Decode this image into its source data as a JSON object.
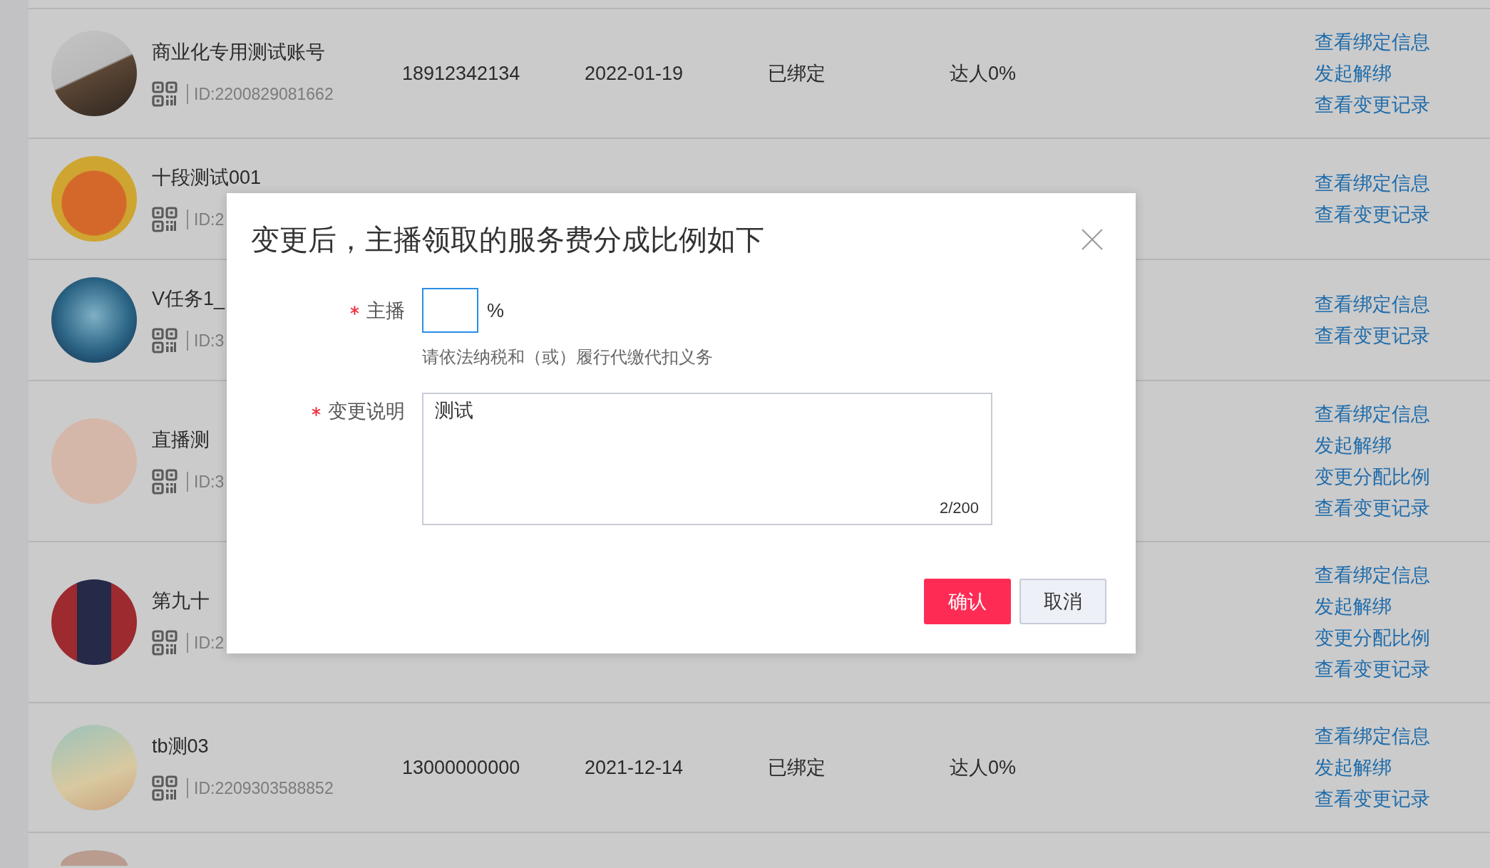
{
  "accounts": [
    {
      "name": "商业化专用测试账号",
      "id": "ID:2200829081662",
      "phone": "18912342134",
      "date": "2022-01-19",
      "status": "已绑定",
      "share": "达人0%",
      "actions": [
        "查看绑定信息",
        "发起解绑",
        "查看变更记录"
      ]
    },
    {
      "name": "十段测试001",
      "id": "ID:2",
      "actions": [
        "查看绑定信息",
        "查看变更记录"
      ]
    },
    {
      "name": "V任务1_",
      "id": "ID:3",
      "actions": [
        "查看绑定信息",
        "查看变更记录"
      ]
    },
    {
      "name": "直播测",
      "id": "ID:3",
      "actions": [
        "查看绑定信息",
        "发起解绑",
        "变更分配比例",
        "查看变更记录"
      ]
    },
    {
      "name": "第九十",
      "id": "ID:2",
      "actions": [
        "查看绑定信息",
        "发起解绑",
        "变更分配比例",
        "查看变更记录"
      ]
    },
    {
      "name": "tb测03",
      "id": "ID:2209303588852",
      "phone": "13000000000",
      "date": "2021-12-14",
      "status": "已绑定",
      "share": "达人0%",
      "actions": [
        "查看绑定信息",
        "发起解绑",
        "查看变更记录"
      ]
    }
  ],
  "dialog": {
    "title": "变更后，主播领取的服务费分成比例如下",
    "fields": [
      {
        "kind": "number",
        "label": "主播",
        "required": true,
        "focused": true,
        "unit": "%",
        "hint": "请依法纳税和（或）履行代缴代扣义务"
      },
      {
        "kind": "textarea",
        "label": "变更说明",
        "required": true,
        "focused": false,
        "value": "测试",
        "counter": "2/200"
      }
    ],
    "buttons": [
      {
        "kind": "primary",
        "label": "确认"
      },
      {
        "kind": "secondary",
        "label": "取消"
      }
    ]
  }
}
